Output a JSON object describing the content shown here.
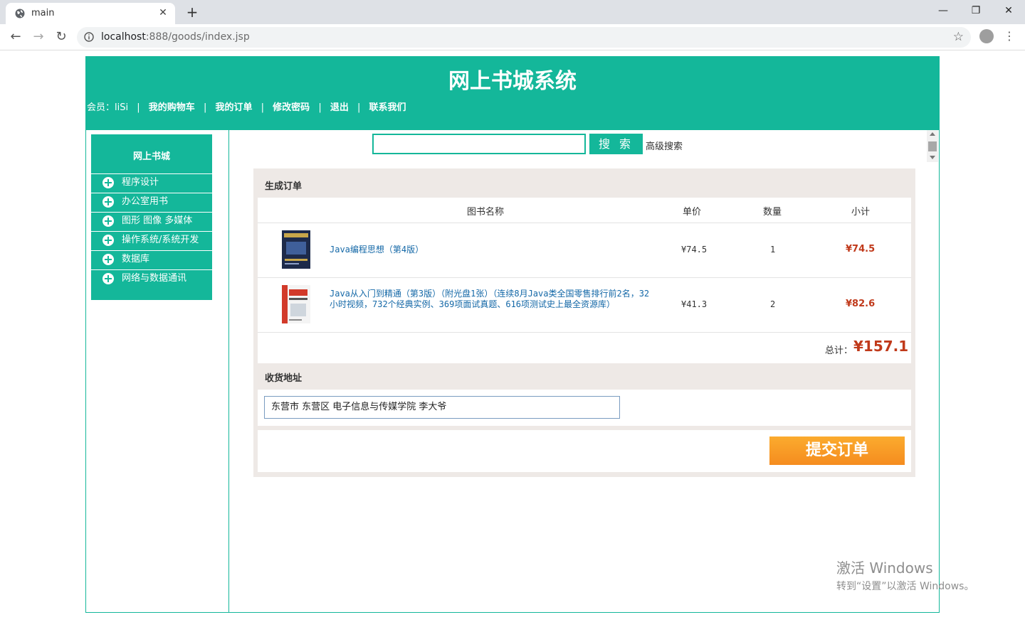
{
  "browser": {
    "tab_title": "main",
    "url_host": "localhost",
    "url_rest": ":888/goods/index.jsp"
  },
  "header": {
    "site_title": "网上书城系统",
    "member_label": "会员：",
    "username": "liSi",
    "links": [
      "我的购物车",
      "我的订单",
      "修改密码",
      "退出",
      "联系我们"
    ],
    "separator": "|"
  },
  "sidebar": {
    "title": "网上书城",
    "categories": [
      "程序设计",
      "办公室用书",
      "图形 图像 多媒体",
      "操作系统/系统开发",
      "数据库",
      "网络与数据通讯"
    ]
  },
  "search": {
    "button_label": "搜 索",
    "advanced_label": "高级搜索",
    "value": ""
  },
  "order": {
    "section_title": "生成订单",
    "columns": [
      "图书名称",
      "单价",
      "数量",
      "小计"
    ],
    "items": [
      {
        "name": "Java编程思想（第4版）",
        "price": "¥74.5",
        "qty": "1",
        "subtotal": "¥74.5"
      },
      {
        "name": "Java从入门到精通（第3版）（附光盘1张）（连续8月Java类全国零售排行前2名，32小时视频，732个经典实例、369项面试真题、616项测试史上最全资源库）",
        "price": "¥41.3",
        "qty": "2",
        "subtotal": "¥82.6"
      }
    ],
    "total_label": "总计：",
    "total_value": "¥157.1"
  },
  "address": {
    "section_title": "收货地址",
    "value": "东营市 东营区 电子信息与传媒学院 李大爷"
  },
  "submit": {
    "label": "提交订单"
  },
  "watermark": {
    "line1": "激活 Windows",
    "line2": "转到“设置”以激活 Windows。"
  },
  "colors": {
    "brand": "#14b79a",
    "price_red": "#c0391a",
    "submit_orange": "#f7961f"
  }
}
